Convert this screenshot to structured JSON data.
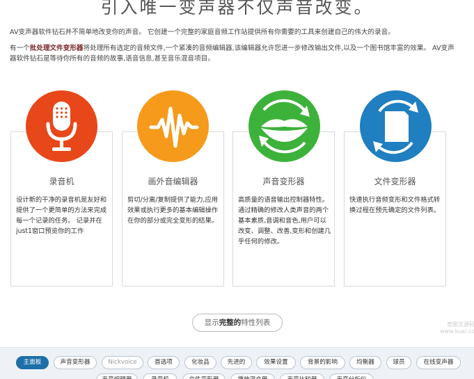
{
  "title": "引入唯一变声器不仅声音改变。",
  "intro": {
    "line1": "AV变声器软件钻石并不简单地改变你的声音。 它创建一个完整的家庭音频工作站提供所有你需要的工具来创建自己的伟大的录音。",
    "line2_prefix": "有一个",
    "line2_bold": "批处理文件变形器",
    "line2_rest": "将处理所有选定的音频文件,一个紧凑的音频编辑器,该编辑器允许您进一步修改输出文件,以及一个图书馆丰富的效果。 AV变声器软件钻石是等待你所有的音频的故事,语音信息,甚至音乐混音项目。"
  },
  "features": [
    {
      "title": "录音机",
      "icon": "microphone-icon",
      "color": "#e8471a",
      "desc": "设计新的干净的录音机是友好和提供了一个更简单的方法来完成每一个记录的任务。 记录并在just1窗口预览你的工作"
    },
    {
      "title": "画外音编辑器",
      "icon": "waveform-icon",
      "color": "#f59a1a",
      "desc": "剪切/分离/复制提供了能力,应用效果或执行更多的基本编辑操作在你的部分或完全变形的结果。"
    },
    {
      "title": "声音变形器",
      "icon": "lips-icon",
      "color": "#3db23a",
      "desc": "高质量的语音输出控制器特性。 通过精确的修改人类声音的两个基本素质,音调和音色,用户可以改变、调整、改善,变形和创建几乎任何的修改。"
    },
    {
      "title": "文件变形器",
      "icon": "file-convert-icon",
      "color": "#1f7fc0",
      "desc": "快速执行音频变形和文件格式转换过程在预先确定的文件列表。"
    }
  ],
  "show_button": {
    "pre": "显示",
    "bold": "完整的",
    "post": "特性列表"
  },
  "watermark": "宽图文源码 www.kuai.co",
  "tags_row1": [
    "主面板",
    "声音变形器",
    "Nickvoice",
    "首选项",
    "化妆品",
    "先进的",
    "效果设置",
    "背景的影响",
    "均衡器",
    "球员",
    "在线变声器"
  ],
  "tags_row2": [
    "声音编辑器",
    "录音机",
    "文件变形器",
    "播放混合器",
    "声音比较器",
    "声音分析仪"
  ],
  "active_tag": "主面板",
  "muted_tag": "Nickvoice"
}
